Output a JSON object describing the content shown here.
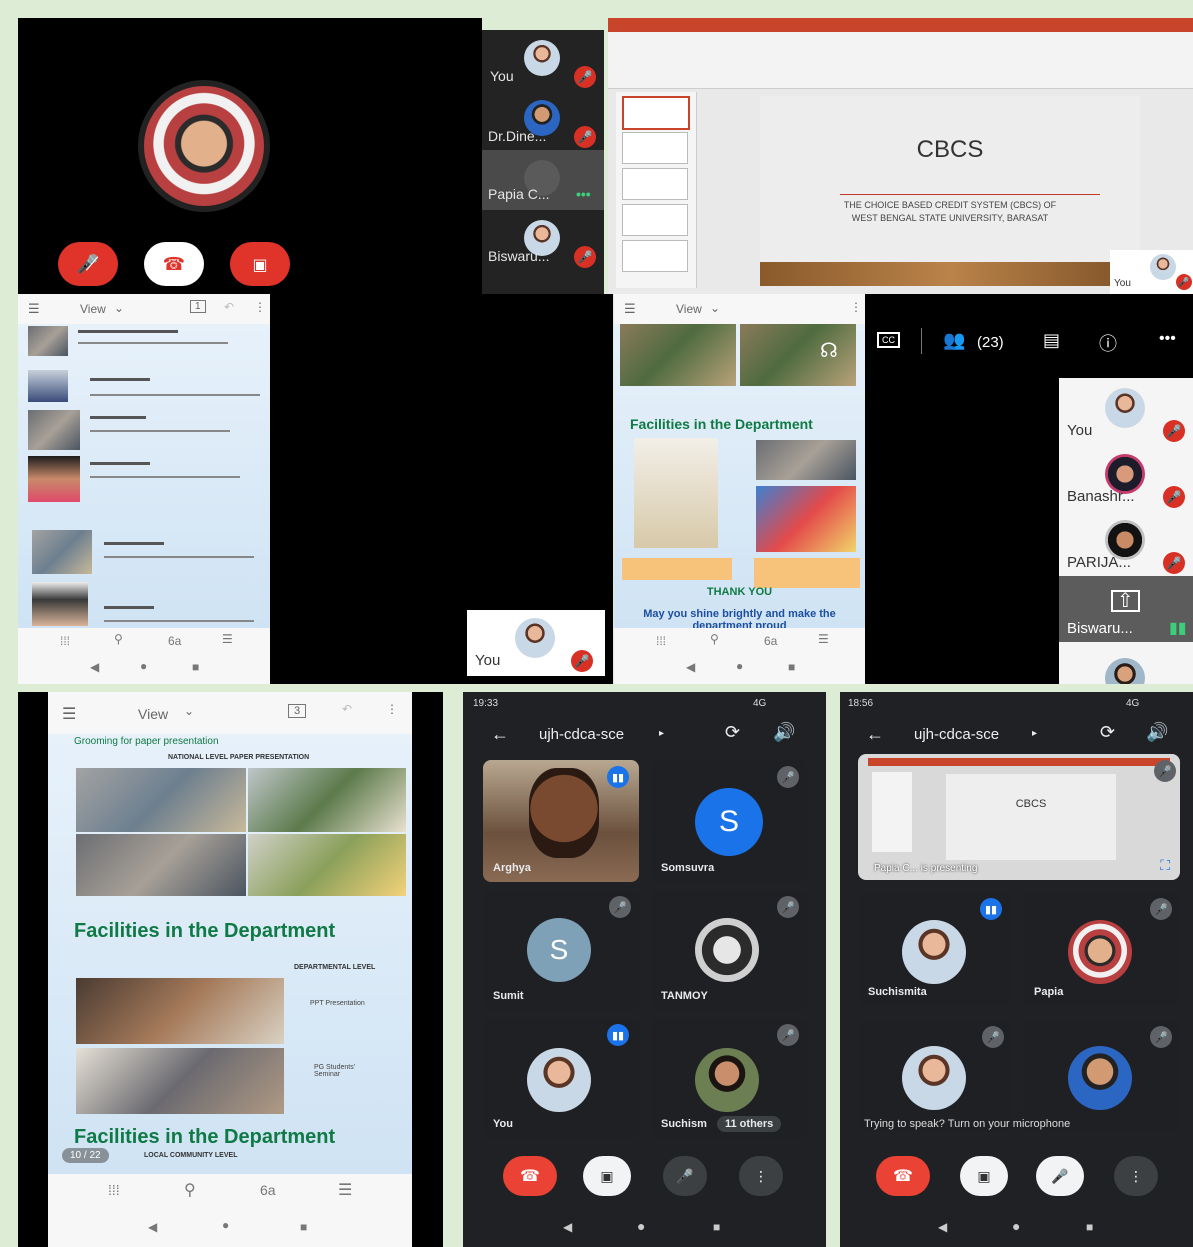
{
  "top_left_call": {
    "end_icon": "phone-end-icon",
    "mic_icon": "mic-off-icon",
    "cam_icon": "camera-off-icon"
  },
  "participants_strip_1": [
    {
      "name": "You"
    },
    {
      "name": "Dr.Dine..."
    },
    {
      "name": "Papia C..."
    },
    {
      "name": "Biswaru..."
    }
  ],
  "slide_cbcs": {
    "title": "CBCS",
    "subtitle_line1": "THE CHOICE BASED CREDIT SYSTEM (CBCS) OF",
    "subtitle_line2": "WEST BENGAL STATE UNIVERSITY, BARASAT",
    "self_label": "You"
  },
  "faculty_viewer": {
    "view_label": "View",
    "page_badge": "1"
  },
  "facilities_viewer": {
    "view_label": "View",
    "heading": "Facilities in the Department",
    "thank_you": "THANK YOU",
    "closing": "May you shine brightly and make the department proud"
  },
  "self_tile_mid": {
    "name": "You"
  },
  "meet_toolbar": {
    "cc_label": "CC",
    "people_count": "(23)"
  },
  "participants_strip_2": [
    {
      "name": "You"
    },
    {
      "name": "Banashr..."
    },
    {
      "name": "PARIJA..."
    },
    {
      "name": "Biswaru..."
    }
  ],
  "bottom_left_viewer": {
    "view_label": "View",
    "page_badge": "3",
    "grooming": "Grooming for paper presentation",
    "national": "NATIONAL LEVEL PAPER PRESENTATION",
    "heading1": "Facilities in the Department",
    "departmental": "DEPARTMENTAL LEVEL",
    "ppt": "PPT Presentation",
    "pg": "PG Students' Seminar",
    "heading2": "Facilities in the Department",
    "local": "LOCAL COMMUNITY LEVEL",
    "page_counter": "10 / 22"
  },
  "meet_phone_1": {
    "time": "19:33",
    "status": "4G",
    "meeting_code": "ujh-cdca-sce",
    "tiles": [
      {
        "name": "Arghya"
      },
      {
        "name": "Somsuvra",
        "initial": "S"
      },
      {
        "name": "Sumit",
        "initial": "S"
      },
      {
        "name": "TANMOY"
      },
      {
        "name": "You"
      },
      {
        "name": "Suchism"
      }
    ],
    "others": "11 others"
  },
  "meet_phone_2": {
    "time": "18:56",
    "status": "4G",
    "meeting_code": "ujh-cdca-sce",
    "presenting_label": "Papia C... is presenting",
    "slide_title": "CBCS",
    "tiles": [
      {
        "name": "Suchismita"
      },
      {
        "name": "Papia"
      },
      {
        "name": ""
      },
      {
        "name": ""
      }
    ],
    "mic_hint": "Trying to speak? Turn on your microphone"
  },
  "colors": {
    "end_red": "#e0342b",
    "meet_dark": "#202124",
    "slide_green": "#0f7a45",
    "border_green": "#dcecd5"
  }
}
